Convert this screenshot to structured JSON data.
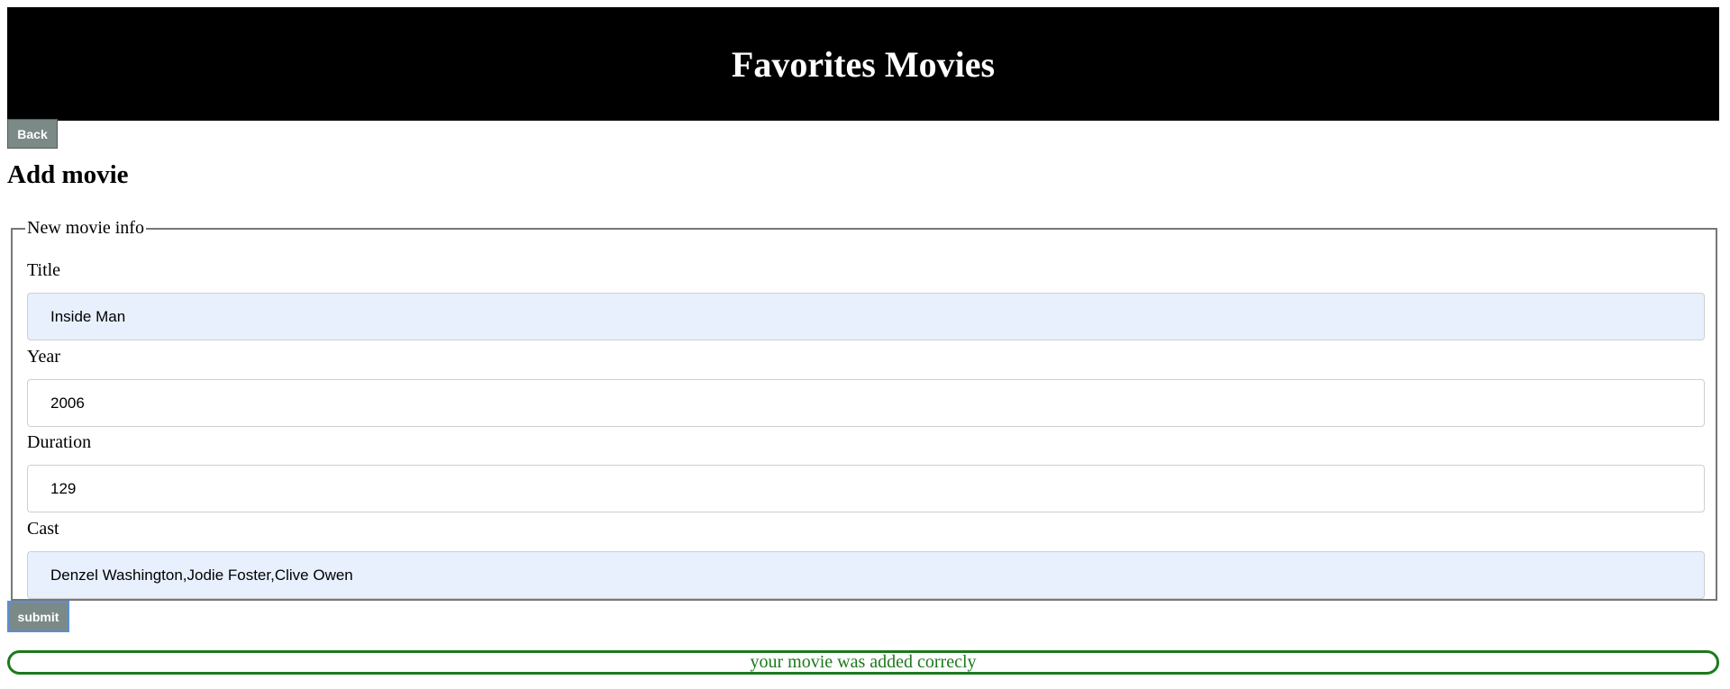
{
  "header": {
    "title": "Favorites Movies"
  },
  "nav": {
    "back_label": "Back"
  },
  "page": {
    "title": "Add movie"
  },
  "form": {
    "legend": "New movie info",
    "fields": [
      {
        "label": "Title",
        "value": "Inside Man"
      },
      {
        "label": "Year",
        "value": "2006"
      },
      {
        "label": "Duration",
        "value": "129"
      },
      {
        "label": "Cast",
        "value": "Denzel Washington,Jodie Foster,Clive Owen"
      }
    ],
    "submit_label": "submit"
  },
  "status": {
    "message": "your movie was added correcly",
    "color": "#1c7a1c"
  },
  "colors": {
    "header_bg": "#000000",
    "button_bg": "#7b8a87",
    "autofill_bg": "#e8f0fe"
  }
}
